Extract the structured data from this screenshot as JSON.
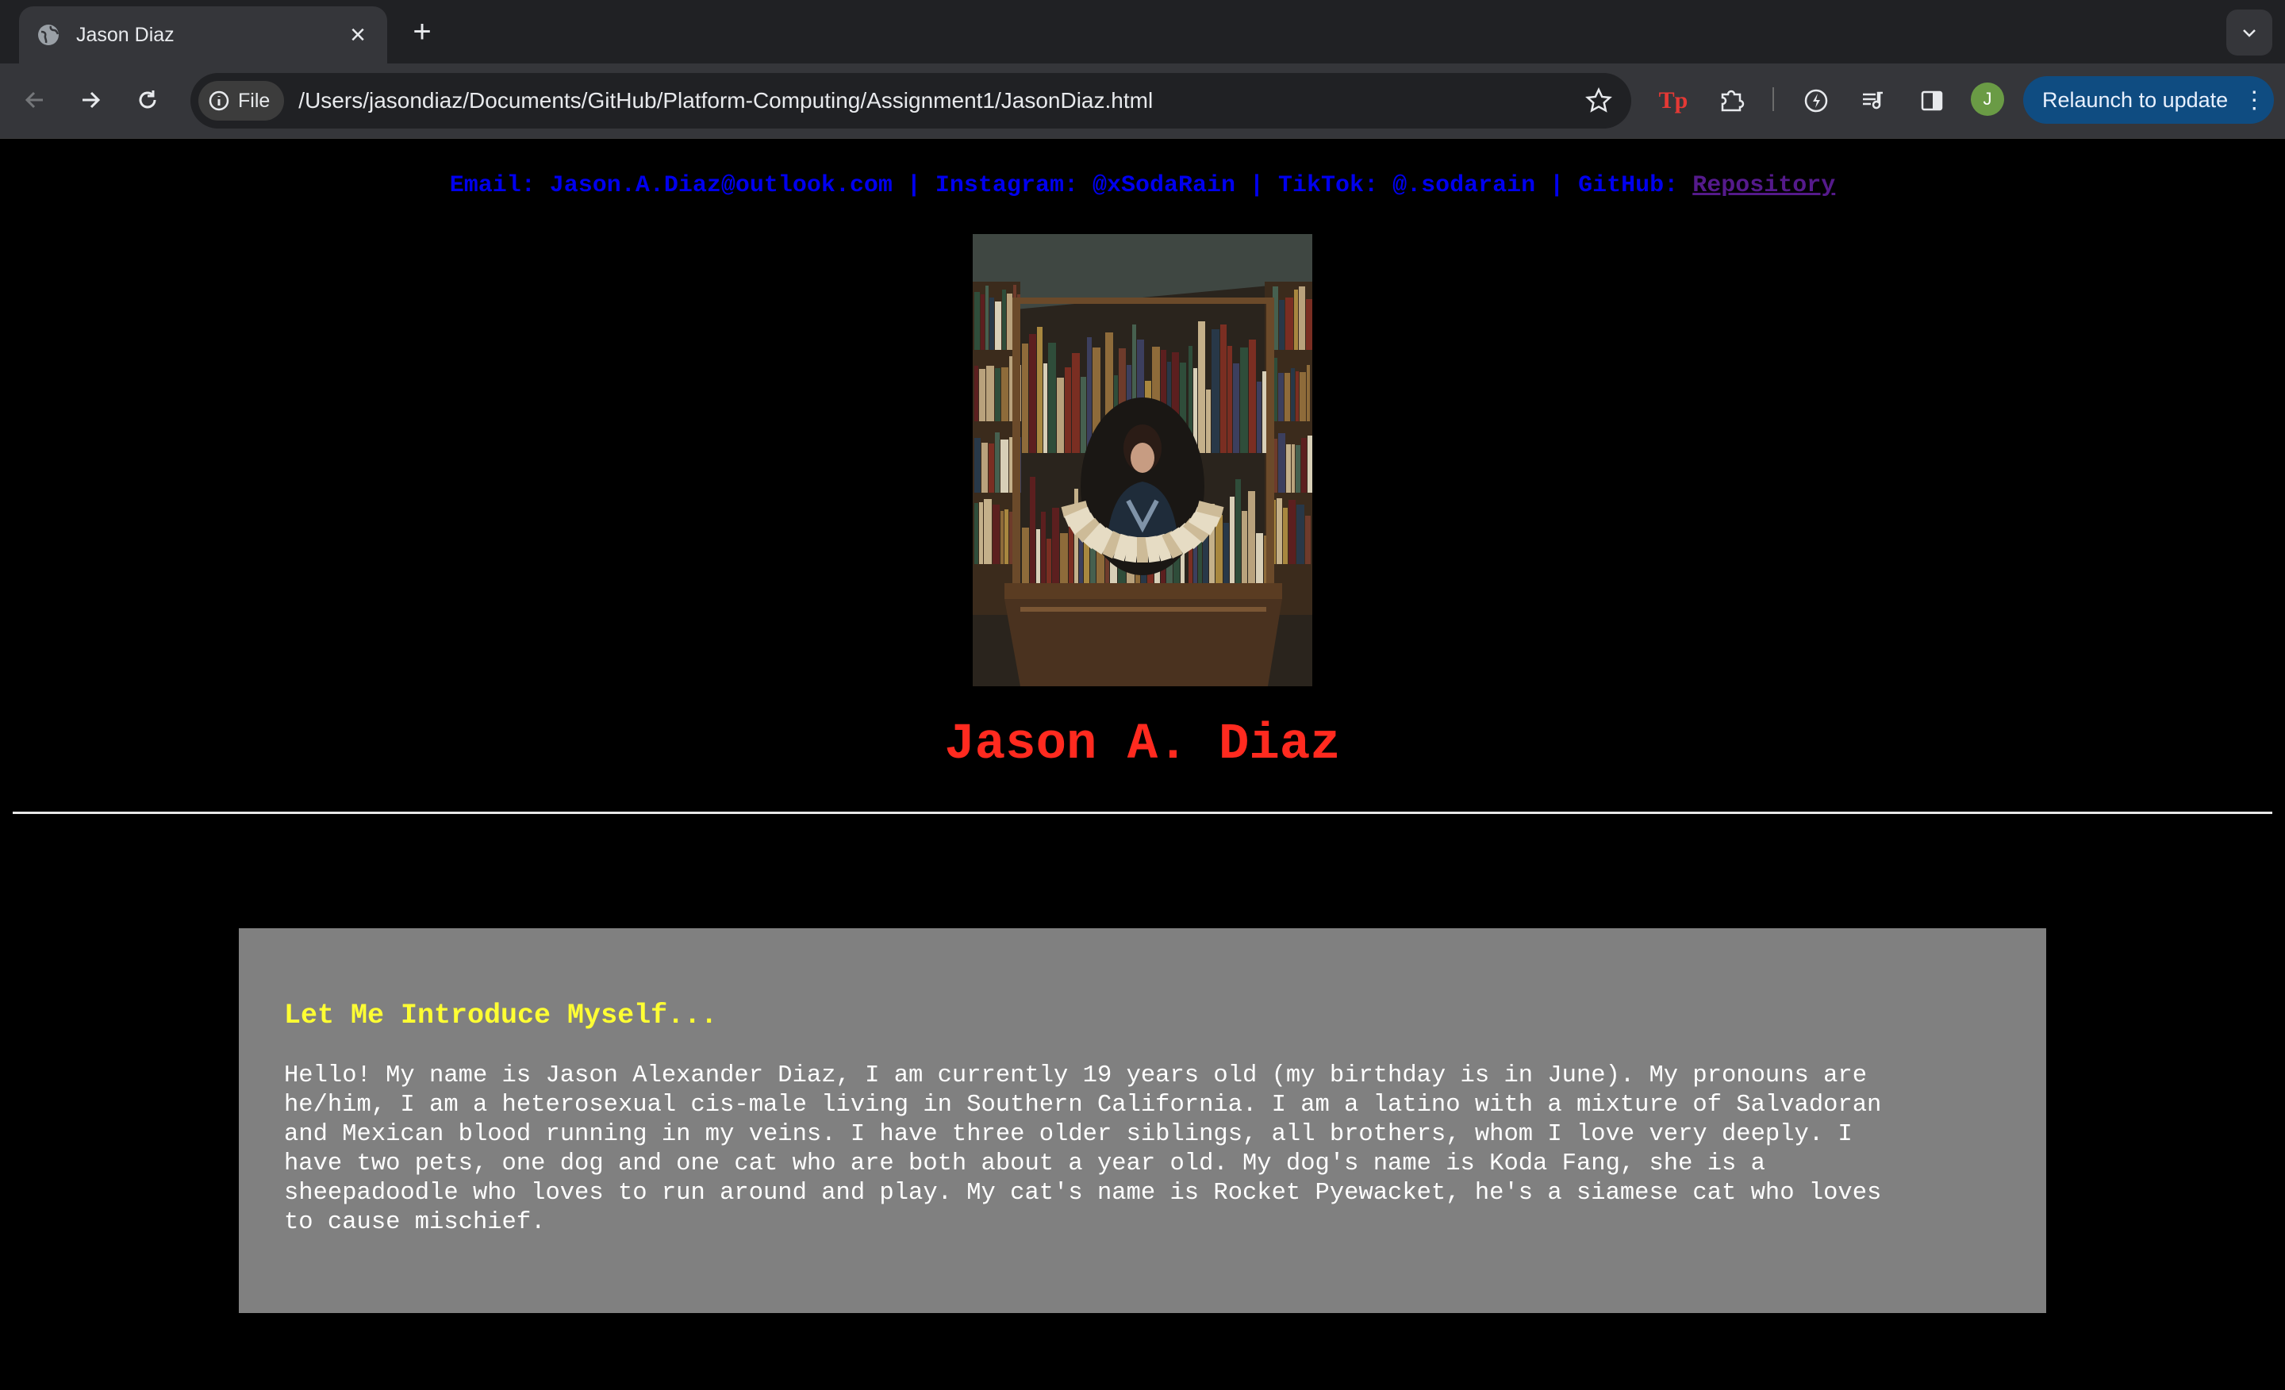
{
  "browser": {
    "tab_title": "Jason Diaz",
    "chip_label": "File",
    "url": "/Users/jasondiaz/Documents/GitHub/Platform-Computing/Assignment1/JasonDiaz.html",
    "avatar_initial": "J",
    "relaunch_label": "Relaunch to update"
  },
  "contact": {
    "email_label": "Email:",
    "email": "Jason.A.Diaz@outlook.com",
    "instagram_label": "Instagram:",
    "instagram": "@xSodaRain",
    "tiktok_label": "TikTok:",
    "tiktok": "@.sodarain",
    "github_label": "GitHub:",
    "github_link": "Repository",
    "separator": "|"
  },
  "profile": {
    "name": "Jason A. Diaz",
    "photo_alt": "Portrait in a bookshop"
  },
  "intro": {
    "heading": "Let Me Introduce Myself...",
    "lines": [
      "Hello! My name is Jason Alexander Diaz, I am currently 19 years old (my birthday is in June). My pronouns are",
      "he/him, I am a heterosexual cis-male living in Southern California. I am a latino with a mixture of Salvadoran",
      "and Mexican blood running in my veins. I have three older siblings, all brothers, whom I love very deeply. I",
      "have two pets, one dog and one cat who are both about a year old. My dog's name is Koda Fang, she is a",
      "sheepadoodle who loves to run around and play. My cat's name is Rocket Pyewacket, he's a siamese cat who loves",
      "to cause mischief."
    ]
  },
  "colors": {
    "page_bg": "#000000",
    "contact_text": "#0000ee",
    "visited_link": "#551a8b",
    "name": "#ff2a1f",
    "intro_bg": "#808080",
    "intro_heading": "#ffff33",
    "intro_text": "#ffffff"
  },
  "icons": [
    "globe-icon",
    "close-icon",
    "plus-icon",
    "chevron-down-icon",
    "back-icon",
    "forward-icon",
    "reload-icon",
    "info-icon",
    "star-icon",
    "tp-extension-icon",
    "puzzle-icon",
    "performance-icon",
    "media-icon",
    "side-panel-icon",
    "more-icon"
  ]
}
